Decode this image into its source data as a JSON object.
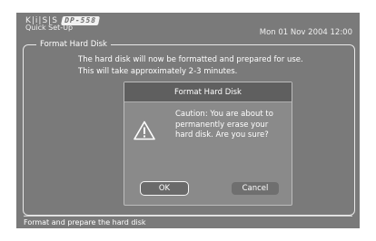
{
  "branding": {
    "logo_text": "K|i|S|S",
    "model": "DP-558"
  },
  "header": {
    "subtitle": "Quick Set-Up",
    "datetime": "Mon 01 Nov 2004 12:00"
  },
  "panel": {
    "title": "Format Hard Disk",
    "message_line1": "The hard disk will now be formatted and prepared for use.",
    "message_line2": "This will take approximately 2-3 minutes."
  },
  "dialog": {
    "title": "Format Hard Disk",
    "caution": "Caution: You are about to permanently erase your hard disk. Are you sure?",
    "icon": "warning-icon",
    "ok_label": "OK",
    "cancel_label": "Cancel",
    "selected_button": "OK"
  },
  "status_bar": {
    "text": "Format and prepare the hard disk"
  },
  "colors": {
    "screen_bg": "#7a7a7a",
    "dialog_header": "#5f5f5f",
    "text": "#ffffff"
  }
}
